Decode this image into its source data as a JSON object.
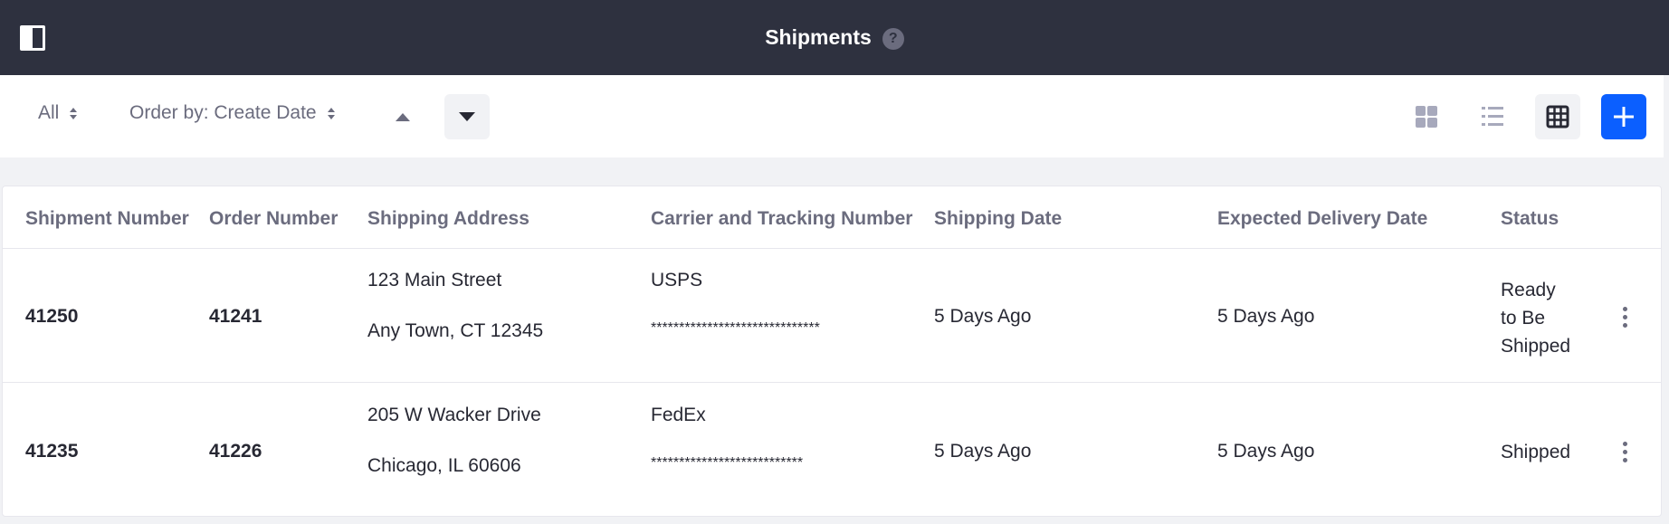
{
  "header": {
    "title": "Shipments",
    "help_glyph": "?",
    "icons": [
      "sidebar-toggle-icon",
      "help-icon"
    ]
  },
  "toolbar": {
    "filter_label": "All",
    "order_label": "Order by: Create Date",
    "sort_ascending_active": false,
    "sort_descending_active": true,
    "views": [
      "cards-view",
      "list-view",
      "table-view"
    ],
    "active_view": "table-view",
    "add_glyph": "+",
    "accent_color": "#0b5fff"
  },
  "table": {
    "columns": [
      "Shipment Number",
      "Order Number",
      "Shipping Address",
      "Carrier and Tracking Number",
      "Shipping Date",
      "Expected Delivery Date",
      "Status"
    ],
    "rows": [
      {
        "shipment_number": "41250",
        "order_number": "41241",
        "address_line1": "123 Main Street",
        "address_line2": "Any Town, CT 12345",
        "carrier": "USPS",
        "tracking": "******************************",
        "shipping_date": "5 Days Ago",
        "expected_delivery": "5 Days Ago",
        "status": "Ready to Be Shipped"
      },
      {
        "shipment_number": "41235",
        "order_number": "41226",
        "address_line1": "205 W Wacker Drive",
        "address_line2": "Chicago, IL 60606",
        "carrier": "FedEx",
        "tracking": "***************************",
        "shipping_date": "5 Days Ago",
        "expected_delivery": "5 Days Ago",
        "status": "Shipped"
      }
    ]
  }
}
